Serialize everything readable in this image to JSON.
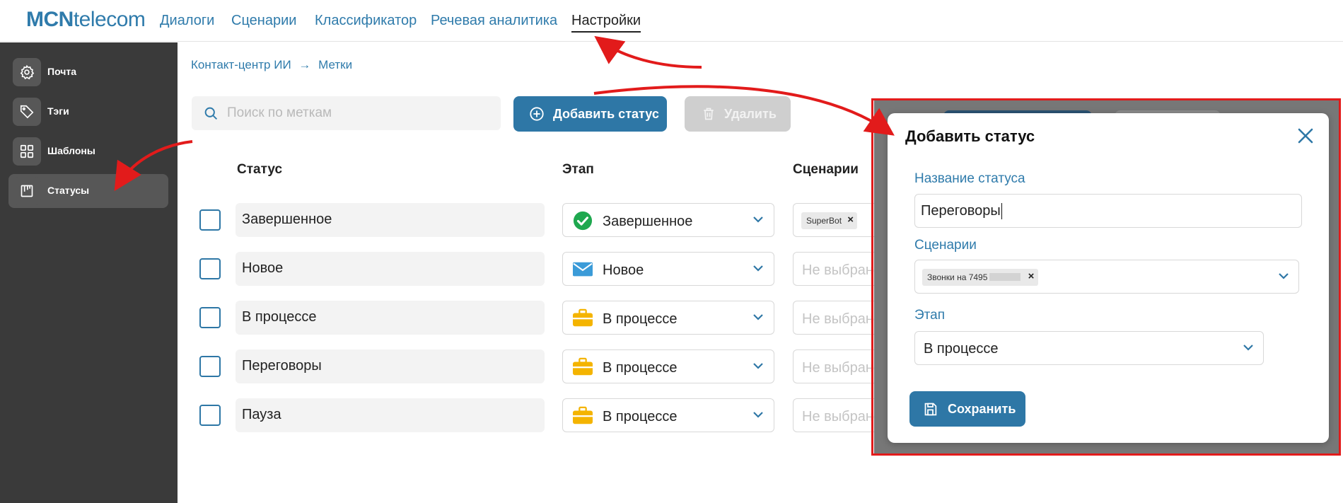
{
  "app": {
    "logo_bold": "MCN",
    "logo_light": "telecom"
  },
  "nav": [
    {
      "label": "Диалоги"
    },
    {
      "label": "Сценарии"
    },
    {
      "label": "Классификатор"
    },
    {
      "label": "Речевая аналитика"
    },
    {
      "label": "Настройки",
      "active": true
    }
  ],
  "sidebar": {
    "items": [
      {
        "label": "Почта",
        "icon": "gear-icon"
      },
      {
        "label": "Тэги",
        "icon": "tag-icon"
      },
      {
        "label": "Шаблоны",
        "icon": "grid-icon"
      },
      {
        "label": "Статусы",
        "icon": "board-icon",
        "active": true
      }
    ]
  },
  "breadcrumb": {
    "parent": "Контакт-центр ИИ",
    "separator": "→",
    "current": "Метки"
  },
  "toolbar": {
    "search_placeholder": "Поиск по меткам",
    "add_label": "Добавить статус",
    "delete_label": "Удалить"
  },
  "table": {
    "headers": {
      "status": "Статус",
      "stage": "Этап",
      "scenarios": "Сценарии"
    },
    "rows": [
      {
        "status": "Завершенное",
        "stage": "Завершенное",
        "stage_icon": "check-circle-icon",
        "scenario_chip": "SuperBot"
      },
      {
        "status": "Новое",
        "stage": "Новое",
        "stage_icon": "envelope-icon",
        "scenario_placeholder": "Не выбрано"
      },
      {
        "status": "В процессе",
        "stage": "В процессе",
        "stage_icon": "briefcase-icon",
        "scenario_placeholder": "Не выбрано"
      },
      {
        "status": "Переговоры",
        "stage": "В процессе",
        "stage_icon": "briefcase-icon",
        "scenario_placeholder": "Не выбрано"
      },
      {
        "status": "Пауза",
        "stage": "В процессе",
        "stage_icon": "briefcase-icon",
        "scenario_placeholder": "Не выбрано"
      }
    ]
  },
  "modal": {
    "title": "Добавить статус",
    "name_label": "Название статуса",
    "name_value": "Переговоры",
    "scenarios_label": "Сценарии",
    "scenario_chip": "Звонки на 7495",
    "stage_label": "Этап",
    "stage_value": "В процессе",
    "save_label": "Сохранить"
  },
  "colors": {
    "accent": "#2e77a6",
    "sidebar": "#3a3a3a",
    "annotation": "#e21b1b",
    "check": "#1fa84f",
    "envelope": "#3b9bd8",
    "briefcase": "#f4b400"
  }
}
